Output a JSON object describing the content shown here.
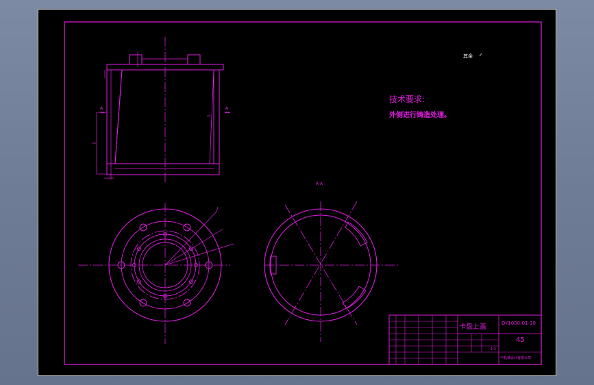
{
  "drawing": {
    "roughness_label": "其余",
    "tech_title": "技术要求:",
    "tech_note": "外侧进行铸造处理。",
    "section_label": "A-A",
    "section_mark_left": "A",
    "section_mark_right": "A",
    "title_block": {
      "part_name": "卡盘上盖",
      "drawing_no": "DY1000-01-30",
      "material": "45",
      "scale": "1:2",
      "company": "**机械设计有限公司"
    }
  },
  "colors": {
    "line": "#e21ce2",
    "paper": "#000000",
    "window": "#6f7c96"
  }
}
